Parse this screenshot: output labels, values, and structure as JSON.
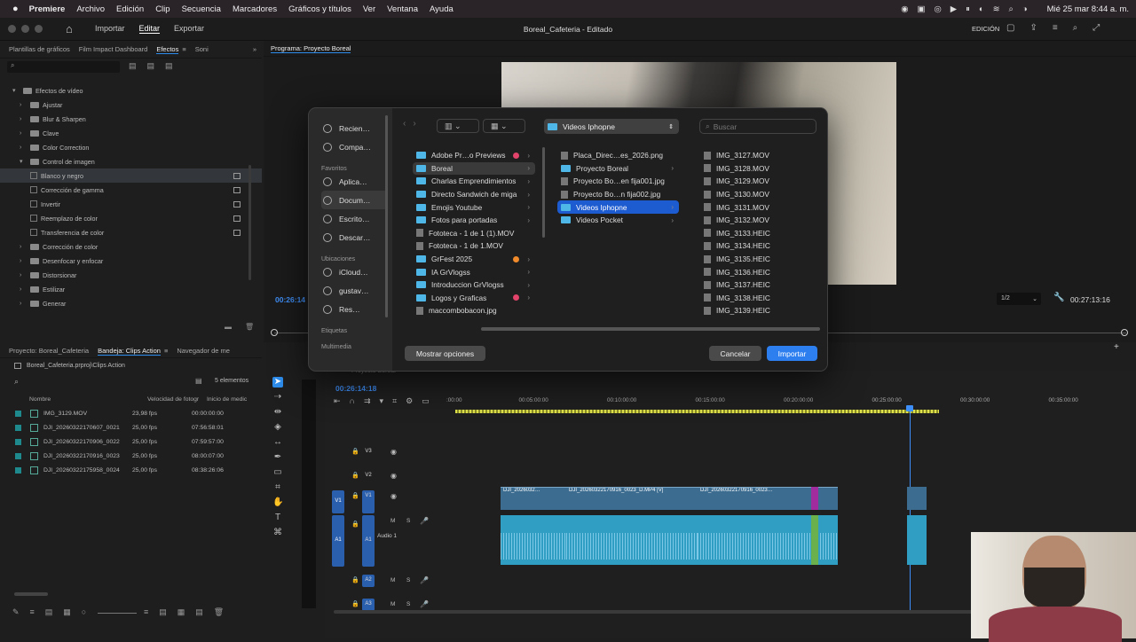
{
  "menubar": {
    "app": "Premiere",
    "items": [
      "Archivo",
      "Edición",
      "Clip",
      "Secuencia",
      "Marcadores",
      "Gráficos y títulos",
      "Ver",
      "Ventana",
      "Ayuda"
    ],
    "clock": "Mié 25 mar 8:44 a. m."
  },
  "titlebar": {
    "nav": [
      "Importar",
      "Editar",
      "Exportar"
    ],
    "active": "Editar",
    "title": "Boreal_Cafeteria - Editado",
    "workspace": "EDICIÓN"
  },
  "effects_panel": {
    "tabs": [
      "Plantillas de gráficos",
      "Film Impact Dashboard",
      "Efectos",
      "Soni"
    ],
    "active": "Efectos",
    "tree": [
      {
        "label": "Efectos de vídeo",
        "level": 0,
        "open": true
      },
      {
        "label": "Ajustar",
        "level": 1
      },
      {
        "label": "Blur & Sharpen",
        "level": 1
      },
      {
        "label": "Clave",
        "level": 1
      },
      {
        "label": "Color Correction",
        "level": 1
      },
      {
        "label": "Control de imagen",
        "level": 1,
        "open": true
      },
      {
        "label": "Blanco y negro",
        "level": 2,
        "selected": true
      },
      {
        "label": "Corrección de gamma",
        "level": 2
      },
      {
        "label": "Invertir",
        "level": 2
      },
      {
        "label": "Reemplazo de color",
        "level": 2
      },
      {
        "label": "Transferencia de color",
        "level": 2
      },
      {
        "label": "Corrección de color",
        "level": 1
      },
      {
        "label": "Desenfocar y enfocar",
        "level": 1
      },
      {
        "label": "Distorsionar",
        "level": 1
      },
      {
        "label": "Estilizar",
        "level": 1
      },
      {
        "label": "Generar",
        "level": 1
      }
    ]
  },
  "program": {
    "title": "Programa: Proyecto Boreal",
    "timecode_left": "00:26:14",
    "timecode_right": "00:27:13:16",
    "resolution": "1/2"
  },
  "project_panel": {
    "tabs": [
      "Proyecto: Boreal_Cafeteria",
      "Bandeja: Clips Action",
      "Navegador de me"
    ],
    "active": "Bandeja: Clips Action",
    "path": "Boreal_Cafeteria.prproj\\Clips Action",
    "count": "5 elementos",
    "headers": [
      "Nombre",
      "Velocidad de fotogr",
      "Inicio de medic"
    ],
    "rows": [
      {
        "name": "IMG_3129.MOV",
        "fps": "23,98 fps",
        "start": "00:00:00:00"
      },
      {
        "name": "DJI_20260322170607_0021",
        "fps": "25,00 fps",
        "start": "07:56:58:01"
      },
      {
        "name": "DJI_20260322170906_0022",
        "fps": "25,00 fps",
        "start": "07:59:57:00"
      },
      {
        "name": "DJI_20260322170916_0023",
        "fps": "25,00 fps",
        "start": "08:00:07:00"
      },
      {
        "name": "DJI_20260322175958_0024",
        "fps": "25,00 fps",
        "start": "08:38:26:06"
      }
    ]
  },
  "timeline": {
    "sequence": "Proyecto Boreal",
    "timecode": "00:26:14:18",
    "ruler": [
      ":00:00",
      "00:05:00:00",
      "00:10:00:00",
      "00:15:00:00",
      "00:20:00:00",
      "00:25:00:00",
      "00:30:00:00",
      "00:35:00:00"
    ],
    "video_tracks": [
      "V3",
      "V2",
      "V1"
    ],
    "audio_tracks": [
      "A1",
      "A2",
      "A3"
    ],
    "audio1_name": "Audio 1",
    "clips": [
      "DJI_2026032…",
      "DJI_20260322170916_0023_D.MP4 [V]",
      "DJI_20260322170916_0023…"
    ]
  },
  "dialog": {
    "location": "Videos Iphopne",
    "search_placeholder": "Buscar",
    "sidebar": [
      {
        "type": "item",
        "label": "Recien…"
      },
      {
        "type": "item",
        "label": "Compa…"
      },
      {
        "type": "header",
        "label": "Favoritos"
      },
      {
        "type": "item",
        "label": "Aplica…"
      },
      {
        "type": "item",
        "label": "Docum…",
        "selected": true
      },
      {
        "type": "item",
        "label": "Escrito…"
      },
      {
        "type": "item",
        "label": "Descar…"
      },
      {
        "type": "header",
        "label": "Ubicaciones"
      },
      {
        "type": "item",
        "label": "iCloud…"
      },
      {
        "type": "item",
        "label": "gustav…"
      },
      {
        "type": "item",
        "label": "Res…"
      },
      {
        "type": "header",
        "label": "Etiquetas"
      },
      {
        "type": "header",
        "label": "Multimedia"
      }
    ],
    "col1": [
      {
        "label": "Adobe Pr…o Previews",
        "kind": "folder",
        "dot": "#e2436a",
        "chev": true
      },
      {
        "label": "Boreal",
        "kind": "folder",
        "state": "dim",
        "chev": true
      },
      {
        "label": "Charlas Emprendimientos",
        "kind": "folder",
        "chev": true
      },
      {
        "label": "Directo Sandwich de miga",
        "kind": "folder",
        "chev": true
      },
      {
        "label": "Emojis Youtube",
        "kind": "folder",
        "chev": true
      },
      {
        "label": "Fotos para portadas",
        "kind": "folder",
        "chev": true
      },
      {
        "label": "Fototeca - 1 de 1 (1).MOV",
        "kind": "file"
      },
      {
        "label": "Fototeca - 1 de 1.MOV",
        "kind": "file"
      },
      {
        "label": "GrFest 2025",
        "kind": "folder",
        "dot": "#f08a2a",
        "chev": true
      },
      {
        "label": "IA GrVlogss",
        "kind": "folder",
        "chev": true
      },
      {
        "label": "Introduccion GrVlogss",
        "kind": "folder",
        "chev": true
      },
      {
        "label": "Logos y Graficas",
        "kind": "folder",
        "dot": "#e2436a",
        "chev": true
      },
      {
        "label": "maccombobacon.jpg",
        "kind": "file"
      }
    ],
    "col2": [
      {
        "label": "Placa_Direc…es_2026.png",
        "kind": "file"
      },
      {
        "label": "Proyecto Boreal",
        "kind": "folder",
        "chev": true
      },
      {
        "label": "Proyecto Bo…en fija001.jpg",
        "kind": "file"
      },
      {
        "label": "Proyecto Bo…n fija002.jpg",
        "kind": "file"
      },
      {
        "label": "Videos Iphopne",
        "kind": "folder",
        "state": "sel",
        "chev": true
      },
      {
        "label": "Videos Pocket",
        "kind": "folder",
        "chev": true
      }
    ],
    "col3": [
      "IMG_3127.MOV",
      "IMG_3128.MOV",
      "IMG_3129.MOV",
      "IMG_3130.MOV",
      "IMG_3131.MOV",
      "IMG_3132.MOV",
      "IMG_3133.HEIC",
      "IMG_3134.HEIC",
      "IMG_3135.HEIC",
      "IMG_3136.HEIC",
      "IMG_3137.HEIC",
      "IMG_3138.HEIC",
      "IMG_3139.HEIC"
    ],
    "options_label": "Mostrar opciones",
    "cancel_label": "Cancelar",
    "import_label": "Importar"
  },
  "colors": {
    "accent": "#2d8ceb",
    "selection": "#1d5bd1",
    "track_blue": "#2a5fae",
    "clip_video": "#3c6d91",
    "clip_audio": "#2f9ec2"
  }
}
